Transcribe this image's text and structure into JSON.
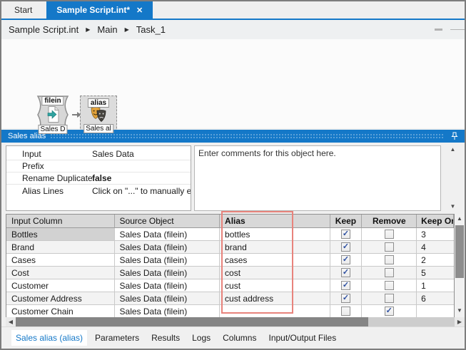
{
  "colors": {
    "accent_blue": "#1478c8",
    "annotation_red": "#e8837c",
    "check_blue": "#2d4fa0"
  },
  "icons": {
    "close": "✕",
    "chevron": "▶",
    "check": "✓",
    "arrow_up": "▲",
    "arrow_down": "▼",
    "arrow_left": "◀",
    "arrow_right": "▶"
  },
  "top_tabs": [
    {
      "label": "Start",
      "active": false
    },
    {
      "label": "Sample Script.int*",
      "active": true
    }
  ],
  "breadcrumb": {
    "items": [
      "Sample Script.int",
      "Main",
      "Task_1"
    ]
  },
  "canvas": {
    "nodes": [
      {
        "title": "filein",
        "label": "Sales D",
        "icon": "file-input-icon"
      },
      {
        "title": "alias",
        "label": "Sales al",
        "icon": "masks-icon"
      }
    ]
  },
  "panel": {
    "title": "Sales alias",
    "properties": [
      {
        "name": "Input",
        "value": "Sales Data",
        "value_bold": false
      },
      {
        "name": "Prefix",
        "value": "",
        "value_bold": false
      },
      {
        "name": "Rename Duplicates",
        "value": "false",
        "value_bold": true
      },
      {
        "name": "Alias Lines",
        "value": "Click on \"...\" to manually edi",
        "value_bold": false
      }
    ],
    "comments_text": "Enter comments for this object here."
  },
  "table": {
    "columns": [
      {
        "label": "Input Column",
        "bold": false
      },
      {
        "label": "Source Object",
        "bold": false
      },
      {
        "label": "Alias",
        "bold": true
      },
      {
        "label": "Keep",
        "bold": true
      },
      {
        "label": "Remove",
        "bold": true
      },
      {
        "label": "Keep Order",
        "bold": true
      }
    ],
    "rows": [
      {
        "input_column": "Bottles",
        "source_object": "Sales Data (filein)",
        "alias": "bottles",
        "keep": true,
        "remove": false,
        "keep_order": "3"
      },
      {
        "input_column": "Brand",
        "source_object": "Sales Data (filein)",
        "alias": "brand",
        "keep": true,
        "remove": false,
        "keep_order": "4"
      },
      {
        "input_column": "Cases",
        "source_object": "Sales Data (filein)",
        "alias": "cases",
        "keep": true,
        "remove": false,
        "keep_order": "2"
      },
      {
        "input_column": "Cost",
        "source_object": "Sales Data (filein)",
        "alias": "cost",
        "keep": true,
        "remove": false,
        "keep_order": "5"
      },
      {
        "input_column": "Customer",
        "source_object": "Sales Data (filein)",
        "alias": "cust",
        "keep": true,
        "remove": false,
        "keep_order": "1"
      },
      {
        "input_column": "Customer Address",
        "source_object": "Sales Data (filein)",
        "alias": "cust address",
        "keep": true,
        "remove": false,
        "keep_order": "6"
      },
      {
        "input_column": "Customer Chain",
        "source_object": "Sales Data (filein)",
        "alias": "",
        "keep": false,
        "remove": true,
        "keep_order": ""
      }
    ]
  },
  "bottom_tabs": [
    {
      "label": "Sales alias (alias)",
      "active": true
    },
    {
      "label": "Parameters",
      "active": false
    },
    {
      "label": "Results",
      "active": false
    },
    {
      "label": "Logs",
      "active": false
    },
    {
      "label": "Columns",
      "active": false
    },
    {
      "label": "Input/Output Files",
      "active": false
    }
  ]
}
